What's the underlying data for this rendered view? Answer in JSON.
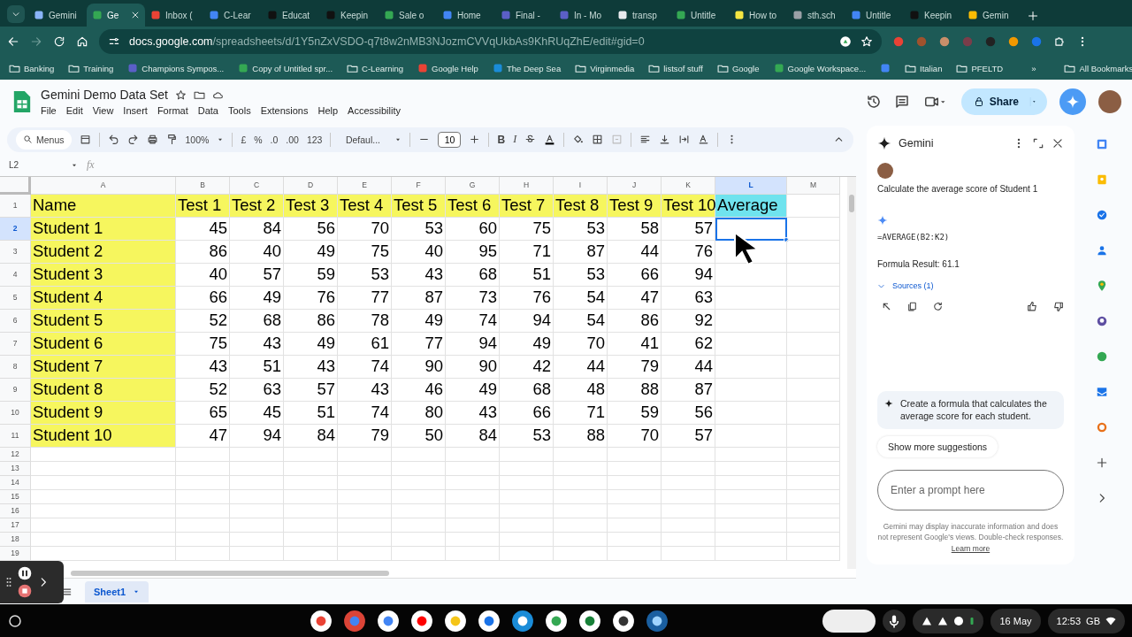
{
  "browser": {
    "tabs": [
      {
        "title": "Gemini",
        "selected": false
      },
      {
        "title": "Ge",
        "selected": true
      },
      {
        "title": "Inbox (",
        "selected": false
      },
      {
        "title": "C-Lear",
        "selected": false
      },
      {
        "title": "Educat",
        "selected": false
      },
      {
        "title": "Keepin",
        "selected": false
      },
      {
        "title": "Sale o",
        "selected": false
      },
      {
        "title": "Home",
        "selected": false
      },
      {
        "title": "Final -",
        "selected": false
      },
      {
        "title": "In - Mo",
        "selected": false
      },
      {
        "title": "transp",
        "selected": false
      },
      {
        "title": "Untitle",
        "selected": false
      },
      {
        "title": "How to",
        "selected": false
      },
      {
        "title": "sth.sch",
        "selected": false
      },
      {
        "title": "Untitle",
        "selected": false
      },
      {
        "title": "Keepin",
        "selected": false
      },
      {
        "title": "Gemin",
        "selected": false
      }
    ],
    "url": {
      "host": "docs.google.com",
      "path": "/spreadsheets/d/1Y5nZxVSDO-q7t8w2nMB3NJozmCVVqUkbAs9KhRUqZhE/edit#gid=0"
    },
    "bookmarks": [
      {
        "label": "Banking",
        "kind": "folder"
      },
      {
        "label": "Training",
        "kind": "folder"
      },
      {
        "label": "Champions Sympos...",
        "kind": "site"
      },
      {
        "label": "Copy of Untitled spr...",
        "kind": "site"
      },
      {
        "label": "C-Learning",
        "kind": "folder"
      },
      {
        "label": "Google Help",
        "kind": "site"
      },
      {
        "label": "The Deep Sea",
        "kind": "site"
      },
      {
        "label": "Virginmedia",
        "kind": "folder"
      },
      {
        "label": "listsof stuff",
        "kind": "folder"
      },
      {
        "label": "Google",
        "kind": "folder"
      },
      {
        "label": "Google Workspace...",
        "kind": "site"
      },
      {
        "kind": "site"
      },
      {
        "label": "Italian",
        "kind": "folder"
      },
      {
        "label": "PFELTD",
        "kind": "folder"
      }
    ],
    "more": "»",
    "all_bookmarks": "All Bookmarks"
  },
  "doc": {
    "title": "Gemini Demo Data Set",
    "menu": [
      "File",
      "Edit",
      "View",
      "Insert",
      "Format",
      "Data",
      "Tools",
      "Extensions",
      "Help",
      "Accessibility"
    ],
    "share": "Share"
  },
  "toolbar": {
    "search": "Menus",
    "zoom": "100%",
    "currency": "£",
    "percent": "%",
    "dec_less": ".0",
    "dec_more": ".00",
    "number_format": "123",
    "font": "Defaul...",
    "size": "10",
    "bold": "B",
    "italic": "I"
  },
  "formula_bar": {
    "name_box": "L2",
    "fx": "fx"
  },
  "sheet": {
    "columns": [
      {
        "label": "A",
        "selected": false
      },
      {
        "label": "B",
        "selected": false
      },
      {
        "label": "C",
        "selected": false
      },
      {
        "label": "D",
        "selected": false
      },
      {
        "label": "E",
        "selected": false
      },
      {
        "label": "F",
        "selected": false
      },
      {
        "label": "G",
        "selected": false
      },
      {
        "label": "H",
        "selected": false
      },
      {
        "label": "I",
        "selected": false
      },
      {
        "label": "J",
        "selected": false
      },
      {
        "label": "K",
        "selected": false
      },
      {
        "label": "L",
        "selected": true
      },
      {
        "label": "M",
        "selected": false
      }
    ],
    "rows": [
      {
        "number": "1",
        "selected": false,
        "cells": [
          {
            "text": "Name",
            "color": "#f6f65e"
          },
          {
            "text": "Test 1",
            "color": "#f6f65e"
          },
          {
            "text": "Test 2",
            "color": "#f6f65e"
          },
          {
            "text": "Test 3",
            "color": "#f6f65e"
          },
          {
            "text": "Test 4",
            "color": "#f6f65e"
          },
          {
            "text": "Test 5",
            "color": "#f6f65e"
          },
          {
            "text": "Test 6",
            "color": "#f6f65e"
          },
          {
            "text": "Test 7",
            "color": "#f6f65e"
          },
          {
            "text": "Test 8",
            "color": "#f6f65e"
          },
          {
            "text": "Test 9",
            "color": "#f6f65e"
          },
          {
            "text": "Test 10",
            "color": "#f6f65e"
          },
          {
            "text": "Average",
            "color": "#6fe3ee"
          }
        ]
      },
      {
        "number": "2",
        "selected": true,
        "cells": [
          {
            "text": "Student 1",
            "color": "#f6f65e"
          },
          "45",
          "84",
          "56",
          "70",
          "53",
          "60",
          "75",
          "53",
          "58",
          "57",
          {
            "selected": true
          }
        ]
      },
      {
        "number": "3",
        "selected": false,
        "cells": [
          {
            "text": "Student 2",
            "color": "#f6f65e"
          },
          "86",
          "40",
          "49",
          "75",
          "40",
          "95",
          "71",
          "87",
          "44",
          "76"
        ]
      },
      {
        "number": "4",
        "selected": false,
        "cells": [
          {
            "text": "Student 3",
            "color": "#f6f65e"
          },
          "40",
          "57",
          "59",
          "53",
          "43",
          "68",
          "51",
          "53",
          "66",
          "94"
        ]
      },
      {
        "number": "5",
        "selected": false,
        "cells": [
          {
            "text": "Student 4",
            "color": "#f6f65e"
          },
          "66",
          "49",
          "76",
          "77",
          "87",
          "73",
          "76",
          "54",
          "47",
          "63"
        ]
      },
      {
        "number": "6",
        "selected": false,
        "cells": [
          {
            "text": "Student 5",
            "color": "#f6f65e"
          },
          "52",
          "68",
          "86",
          "78",
          "49",
          "74",
          "94",
          "54",
          "86",
          "92"
        ]
      },
      {
        "number": "7",
        "selected": false,
        "cells": [
          {
            "text": "Student 6",
            "color": "#f6f65e"
          },
          "75",
          "43",
          "49",
          "61",
          "77",
          "94",
          "49",
          "70",
          "41",
          "62"
        ]
      },
      {
        "number": "8",
        "selected": false,
        "cells": [
          {
            "text": "Student 7",
            "color": "#f6f65e"
          },
          "43",
          "51",
          "43",
          "74",
          "90",
          "90",
          "42",
          "44",
          "79",
          "44"
        ]
      },
      {
        "number": "9",
        "selected": false,
        "cells": [
          {
            "text": "Student 8",
            "color": "#f6f65e"
          },
          "52",
          "63",
          "57",
          "43",
          "46",
          "49",
          "68",
          "48",
          "88",
          "87"
        ]
      },
      {
        "number": "10",
        "selected": false,
        "cells": [
          {
            "text": "Student 9",
            "color": "#f6f65e"
          },
          "65",
          "45",
          "51",
          "74",
          "80",
          "43",
          "66",
          "71",
          "59",
          "56"
        ]
      },
      {
        "number": "11",
        "selected": false,
        "cells": [
          {
            "text": "Student 10",
            "color": "#f6f65e"
          },
          "47",
          "94",
          "84",
          "79",
          "50",
          "84",
          "53",
          "88",
          "70",
          "57"
        ]
      },
      {
        "number": "12",
        "selected": false
      },
      {
        "number": "13",
        "selected": false
      },
      {
        "number": "14",
        "selected": false
      },
      {
        "number": "15",
        "selected": false
      },
      {
        "number": "16",
        "selected": false
      },
      {
        "number": "17",
        "selected": false
      },
      {
        "number": "18",
        "selected": false
      },
      {
        "number": "19",
        "selected": false
      }
    ],
    "tabs": [
      {
        "label": "Sheet1",
        "selected": true
      }
    ]
  },
  "gemini": {
    "title": "Gemini",
    "prompt": "Calculate the average score of Student 1",
    "formula": "=AVERAGE(B2:K2)",
    "result": "Formula Result: 61.1",
    "sources": {
      "label": "Sources (1)",
      "expanded": false
    },
    "suggestion": "Create a formula that calculates the average score for each student.",
    "more_suggestions": "Show more suggestions",
    "input": {
      "placeholder": "Enter a prompt here"
    },
    "disclaimer": "Gemini may display inaccurate information and does not represent Google's views. Double-check responses.",
    "learn_more": "Learn more"
  },
  "taskbar": {
    "date": "16 May",
    "time": "12:53",
    "locale": "GB"
  }
}
